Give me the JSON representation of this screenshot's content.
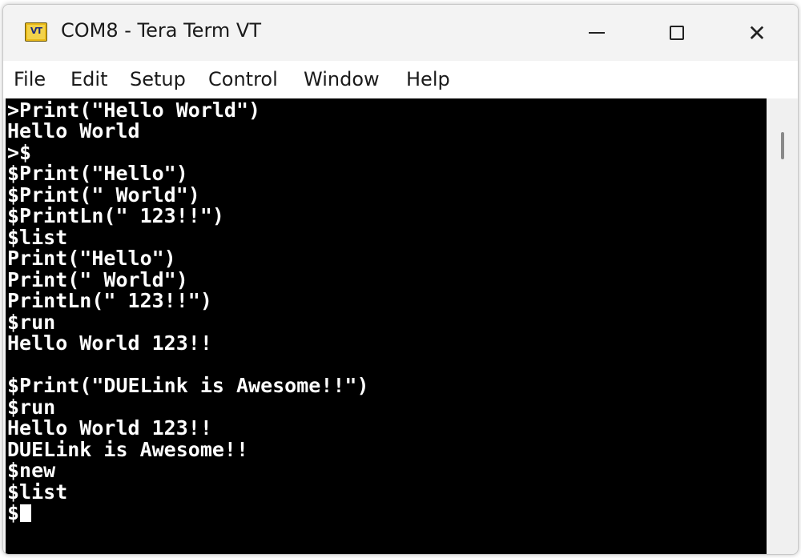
{
  "window": {
    "title": "COM8 - Tera Term VT",
    "icon_text": "VT",
    "icon_name": "tera-term-icon",
    "controls": {
      "minimize_icon": "minimize-icon",
      "maximize_icon": "maximize-icon",
      "close_icon": "close-icon",
      "close_glyph": "✕"
    }
  },
  "menu": {
    "items": [
      "File",
      "Edit",
      "Setup",
      "Control",
      "Window",
      "Help"
    ]
  },
  "terminal": {
    "lines": [
      ">Print(\"Hello World\")",
      "Hello World",
      ">$",
      "$Print(\"Hello\")",
      "$Print(\" World\")",
      "$PrintLn(\" 123!!\")",
      "$list",
      "Print(\"Hello\")",
      "Print(\" World\")",
      "PrintLn(\" 123!!\")",
      "$run",
      "Hello World 123!!",
      "",
      "$Print(\"DUELink is Awesome!!\")",
      "$run",
      "Hello World 123!!",
      "DUELink is Awesome!!",
      "$new",
      "$list",
      "$"
    ],
    "background": "#000000",
    "foreground": "#ffffff"
  }
}
